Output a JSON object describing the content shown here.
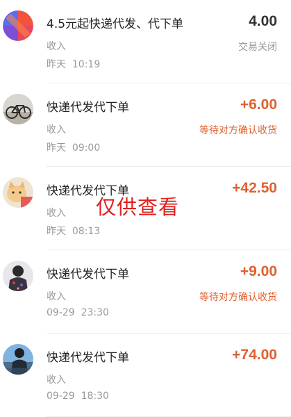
{
  "transactions": [
    {
      "title": "4.5元起快递代发、代下单",
      "type": "收入",
      "time": "昨天  10:19",
      "amount": "4.00",
      "status": "交易关闭",
      "avatar_icon": "colorful-logo-avatar"
    },
    {
      "title": "快递代发代下单",
      "type": "收入",
      "time": "昨天  09:00",
      "amount": "+6.00",
      "status": "等待对方确认收货",
      "avatar_icon": "bicycle-photo-avatar"
    },
    {
      "title": "快递代发代下单",
      "type": "收入",
      "time": "昨天  08:13",
      "amount": "+42.50",
      "status": "",
      "avatar_icon": "cat-photo-avatar"
    },
    {
      "title": "快递代发代下单",
      "type": "收入",
      "time": "09-29  23:30",
      "amount": "+9.00",
      "status": "等待对方确认收货",
      "avatar_icon": "person-photo-avatar"
    },
    {
      "title": "快递代发代下单",
      "type": "收入",
      "time": "09-29  18:30",
      "amount": "+74.00",
      "status": "",
      "avatar_icon": "landscape-person-avatar"
    }
  ],
  "watermark": "仅供查看",
  "colors": {
    "amount_accent": "#e0602e",
    "closed_amount": "#333333",
    "watermark": "#e02020"
  }
}
